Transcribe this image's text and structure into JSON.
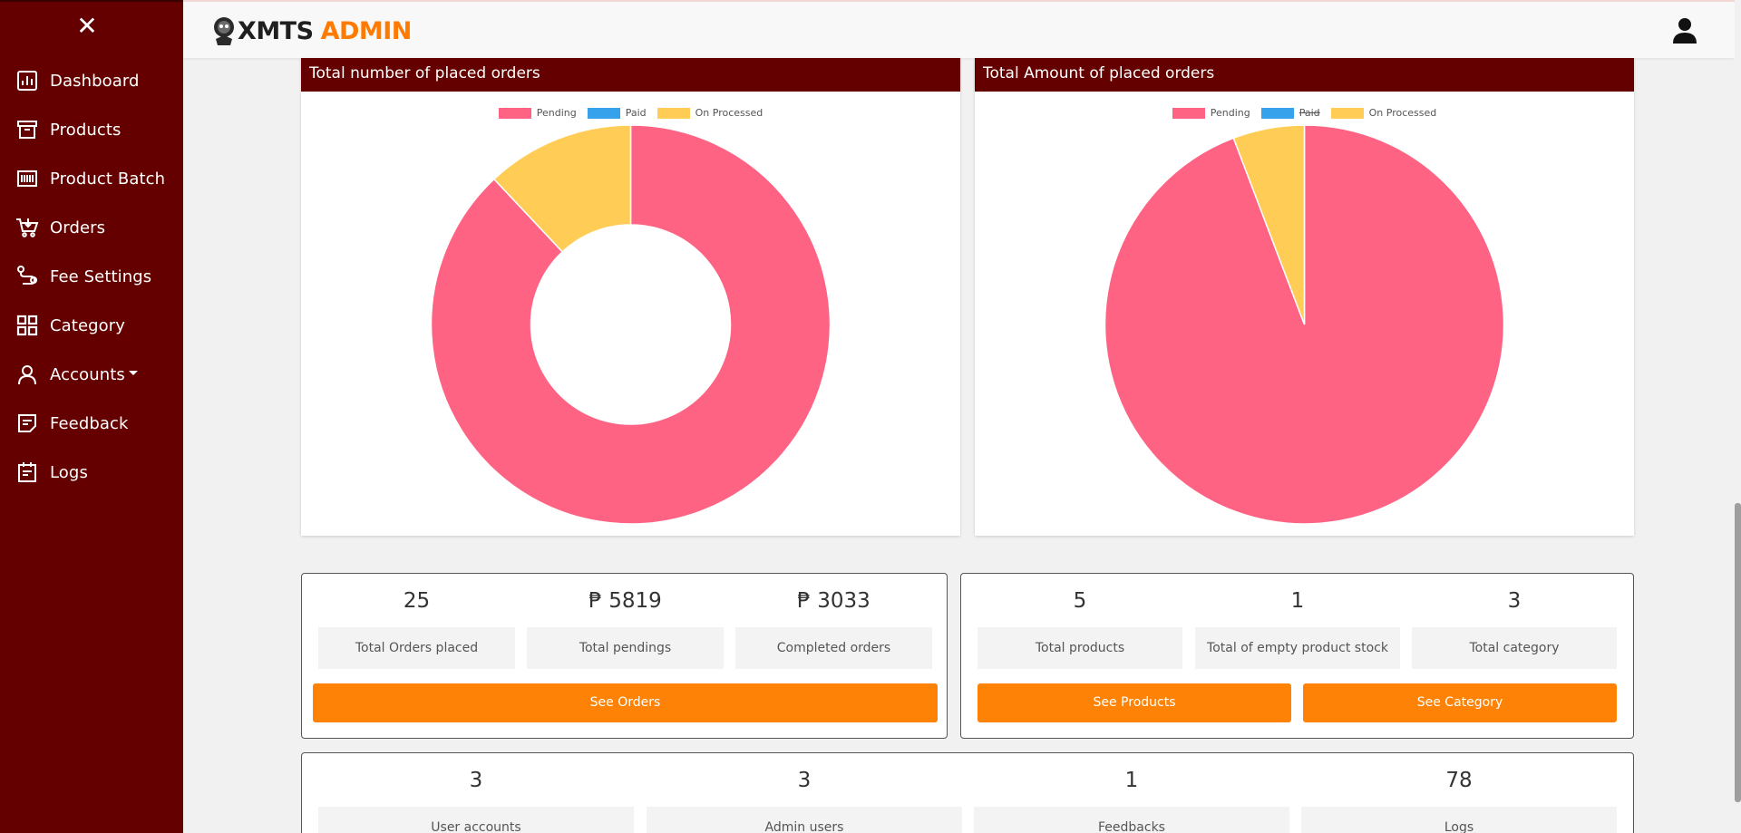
{
  "sidebar": {
    "close_icon": "close-icon",
    "items": [
      {
        "label": "Dashboard",
        "icon": "bar-chart-icon"
      },
      {
        "label": "Products",
        "icon": "archive-box-icon"
      },
      {
        "label": "Product Batch",
        "icon": "barcode-icon"
      },
      {
        "label": "Orders",
        "icon": "cart-icon"
      },
      {
        "label": "Fee Settings",
        "icon": "route-icon"
      },
      {
        "label": "Category",
        "icon": "grid-icon"
      },
      {
        "label": "Accounts",
        "icon": "person-icon"
      },
      {
        "label": "Feedback",
        "icon": "document-icon"
      },
      {
        "label": "Logs",
        "icon": "calendar-icon"
      }
    ],
    "color": "#640000"
  },
  "header": {
    "logo_part1": "XMTS",
    "logo_part2": "ADMIN",
    "user_icon": "user-icon"
  },
  "charts": [
    {
      "title": "Total number of placed orders",
      "legend": [
        "Pending",
        "Paid",
        "On Processed"
      ]
    },
    {
      "title": "Total Amount of placed orders",
      "legend": [
        "Pending",
        "Paid",
        "On Processed"
      ]
    }
  ],
  "chart_data": [
    {
      "type": "pie",
      "variant": "doughnut",
      "categories": [
        "Pending",
        "Paid",
        "On Processed"
      ],
      "values": [
        22,
        0,
        3
      ],
      "colors": [
        "#ff6384",
        "#36a2eb",
        "#ffcd56"
      ],
      "legend": "top"
    },
    {
      "type": "pie",
      "categories": [
        "Pending",
        "Paid",
        "On Processed"
      ],
      "values": [
        5819,
        0,
        357
      ],
      "colors": [
        "#ff6384",
        "#36a2eb",
        "#ffcd56"
      ],
      "hidden": [
        "Paid"
      ],
      "legend": "top"
    }
  ],
  "orders_card": {
    "stats": [
      {
        "value": "25",
        "label": "Total Orders placed"
      },
      {
        "value": "₱ 5819",
        "label": "Total pendings"
      },
      {
        "value": "₱ 3033",
        "label": "Completed orders"
      }
    ],
    "button": "See Orders"
  },
  "products_card": {
    "stats": [
      {
        "value": "5",
        "label": "Total products"
      },
      {
        "value": "1",
        "label": "Total of empty product stock"
      },
      {
        "value": "3",
        "label": "Total category"
      }
    ],
    "buttons": [
      "See Products",
      "See Category"
    ]
  },
  "users_card": {
    "stats": [
      {
        "value": "3",
        "label": "User accounts"
      },
      {
        "value": "3",
        "label": "Admin users"
      },
      {
        "value": "1",
        "label": "Feedbacks"
      },
      {
        "value": "78",
        "label": "Logs"
      }
    ]
  },
  "accent_color": "#fd8205"
}
